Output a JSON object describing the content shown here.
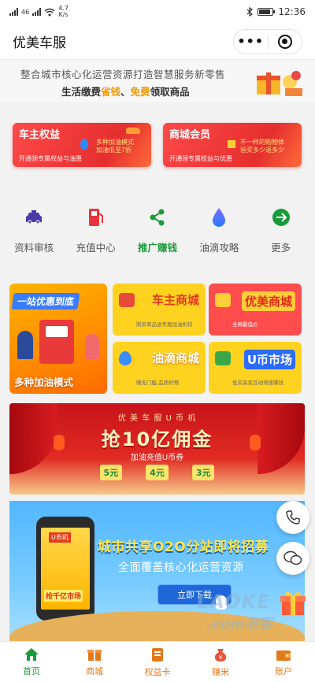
{
  "status_bar": {
    "signal_label": "46",
    "speed_value": "4.7",
    "speed_unit": "K/s",
    "time": "12:36"
  },
  "nav": {
    "title": "优美车服",
    "more_glyph": "•••"
  },
  "top_banner": {
    "line1": "整合城市核心化运营资源打造智慧服务新零售",
    "line2_prefix": "生活缴费",
    "line2_hl1": "省钱",
    "line2_sep": "、",
    "line2_hl2": "免费",
    "line2_suffix": "领取商品"
  },
  "member_cards": [
    {
      "title": "车主权益",
      "promo_line1": "多种加油模式",
      "promo_line2": "加油低至7折",
      "subtitle": "开通领专属权益与油惠"
    },
    {
      "title": "商城会员",
      "promo_line1": "不一样的购物体",
      "promo_line2": "验买多少返多少",
      "subtitle": "开通领专属权益与优惠"
    }
  ],
  "quick_nav": [
    {
      "label": "资料审核",
      "icon": "taxi-icon",
      "color": "#4a3aa8"
    },
    {
      "label": "充值中心",
      "icon": "fuel-pump-icon",
      "color": "#e8343a"
    },
    {
      "label": "推广赚钱",
      "icon": "share-icon",
      "color": "#1a9b3a"
    },
    {
      "label": "油滴攻略",
      "icon": "drop-icon",
      "color": "#5a6cff"
    },
    {
      "label": "更多",
      "icon": "arrow-right-icon",
      "color": "#1a9b3a"
    }
  ],
  "promo_grid": {
    "big_card": {
      "head": "一站优惠到底",
      "foot": "多种加油模式"
    },
    "mini_cards": [
      {
        "title": "车主商城",
        "subtitle": "购买商品送专属加油折扣"
      },
      {
        "title": "优美商城",
        "subtitle": "全网最低价"
      },
      {
        "title": "油滴商城",
        "subtitle": "赠无门槛  品质好物"
      },
      {
        "title": "U币市场",
        "subtitle": "低买高卖互动增值赚钱"
      }
    ]
  },
  "red_banner": {
    "top": "优 美 车 服 U 币 机",
    "title": "抢10亿佣金",
    "sub": "加油充值U币券",
    "coupons": [
      "5元",
      "4元",
      "3元"
    ]
  },
  "blue_banner": {
    "phone_tag": "U币机",
    "phone_bottom": "抢千亿市场",
    "title": "城市共享O2O分站即将招募",
    "subtitle": "全面覆盖核心化运营资源",
    "button": "立即下载"
  },
  "watermark": {
    "text1": "LAOKE",
    "text2": ".com老客"
  },
  "tab_bar": [
    {
      "label": "首页",
      "icon": "home-icon",
      "active": true
    },
    {
      "label": "商城",
      "icon": "shop-icon",
      "active": false
    },
    {
      "label": "权益卡",
      "icon": "card-icon",
      "active": false
    },
    {
      "label": "赚米",
      "icon": "money-bag-icon",
      "active": false
    },
    {
      "label": "账户",
      "icon": "wallet-icon",
      "active": false
    }
  ],
  "colors": {
    "accent_green": "#1a9b3a",
    "accent_orange": "#f39800",
    "card_red": "#e52e2e",
    "tab_orange": "#e07a1a"
  }
}
